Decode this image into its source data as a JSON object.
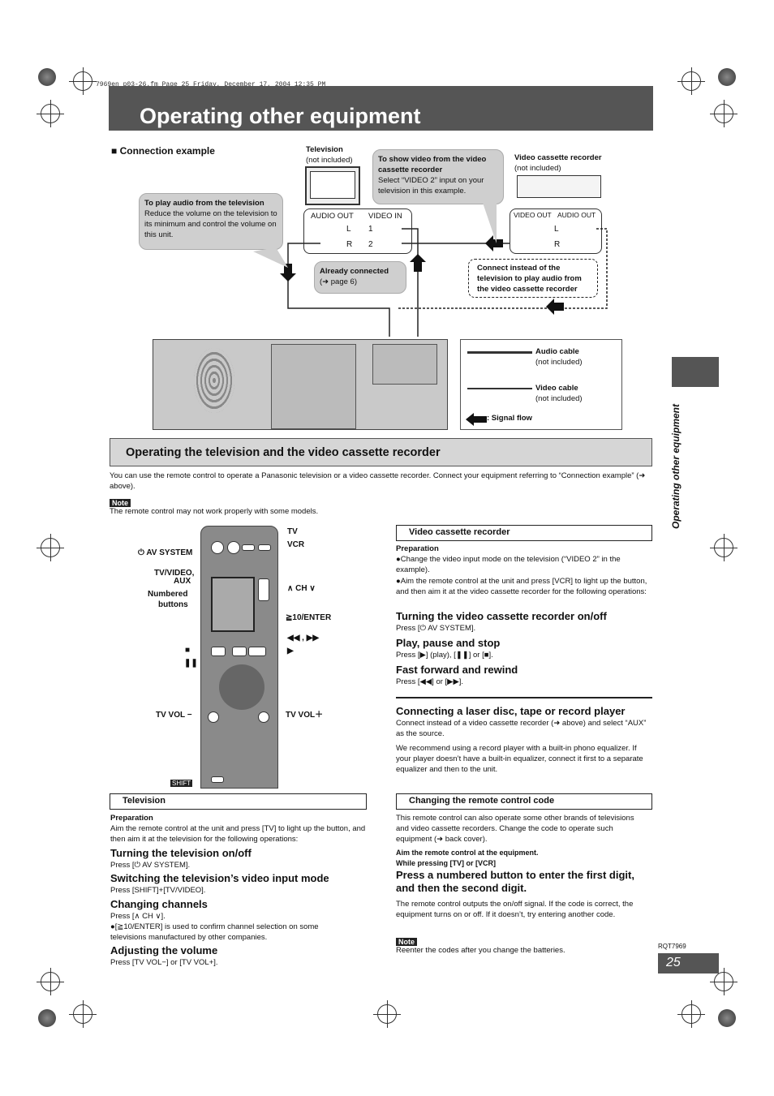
{
  "file_tag": "7969en_p03-26.fm  Page 25  Friday, December 17, 2004  12:35 PM",
  "title": "Operating other equipment",
  "connection": {
    "heading": "■ Connection example",
    "tv_title": "Television",
    "tv_sub": "(not included)",
    "vcr_title": "Video cassette recorder",
    "vcr_sub": "(not included)",
    "bubble_audio_title": "To play audio from the television",
    "bubble_audio_text": "Reduce the volume on the television to its minimum and control the volume on this unit.",
    "bubble_video_title": "To show video from the video cassette recorder",
    "bubble_video_text": "Select “VIDEO 2” input on your television in this example.",
    "already_title": "Already connected",
    "already_text": "(➜ page 6)",
    "instead_text": "Connect instead of the television to play audio from the video cassette recorder",
    "tv_audio_out": "AUDIO OUT",
    "tv_video_in": "VIDEO IN",
    "l": "L",
    "r": "R",
    "in1": "1",
    "in2": "2",
    "vcr_video_out": "VIDEO OUT",
    "vcr_audio_out": "AUDIO OUT",
    "legend": {
      "audio": "Audio cable",
      "audio_sub": "(not included)",
      "video": "Video cable",
      "video_sub": "(not included)",
      "signal": ": Signal flow"
    }
  },
  "section": {
    "title": "Operating the television and the video cassette recorder",
    "intro": "You can use the remote control to operate a Panasonic television or a video cassette recorder. Connect your equipment referring to “Connection example” (➜ above).",
    "note_label": "Note",
    "note": "The remote control may not work properly with some models."
  },
  "remote_labels": {
    "tv": "TV",
    "vcr": "VCR",
    "av_system": "⏻ AV SYSTEM",
    "tv_video": "TV/VIDEO,",
    "aux": "AUX",
    "numbered": "Numbered",
    "buttons": "buttons",
    "ch": "∧ CH ∨",
    "enter10": "≧10/ENTER",
    "skip": "◀◀ , ▶▶",
    "stop": "■",
    "pause": "❚❚",
    "play": "▶",
    "tv_vol_minus": "TV VOL −",
    "tv_vol_plus": "TV VOL＋",
    "shift": "SHIFT"
  },
  "television": {
    "box": "Television",
    "prep": "Preparation",
    "prep_text": "Aim the remote control at the unit and press [TV] to light up the button, and then aim it at the television for the following operations:",
    "items": [
      {
        "h": "Turning the television on/off",
        "t": "Press [⏻ AV SYSTEM]."
      },
      {
        "h": "Switching the television’s video input mode",
        "t": "Press [SHIFT]+[TV/VIDEO]."
      },
      {
        "h": "Changing channels",
        "t": "Press [∧ CH ∨]."
      },
      {
        "h": "Adjusting the volume",
        "t": "Press [TV VOL−] or [TV VOL+]."
      }
    ],
    "ch_bullet": "●[≧10/ENTER] is used to confirm channel selection on some televisions manufactured by other companies."
  },
  "vcr": {
    "box": "Video cassette recorder",
    "prep": "Preparation",
    "bullets": [
      "●Change the video input mode on the television (“VIDEO 2” in the example).",
      "●Aim the remote control at the unit and press [VCR] to light up the button, and then aim it at the video cassette recorder for the following operations:"
    ],
    "items": [
      {
        "h": "Turning the video cassette recorder on/off",
        "t": "Press [⏻ AV SYSTEM]."
      },
      {
        "h": "Play, pause and stop",
        "t": "Press [▶] (play), [❚❚] or [■]."
      },
      {
        "h": "Fast forward and rewind",
        "t": "Press [◀◀] or [▶▶]."
      }
    ]
  },
  "laser": {
    "h": "Connecting a laser disc, tape or record player",
    "p1": "Connect instead of a video cassette recorder (➜ above) and select “AUX” as the source.",
    "p2": "We recommend using a record player with a built-in phono equalizer. If your player doesn’t have a built-in equalizer, connect it first to a separate equalizer and then to the unit."
  },
  "code": {
    "box": "Changing the remote control code",
    "p1": "This remote control can also operate some other brands of televisions and video cassette recorders. Change the code to operate such equipment (➜ back cover).",
    "s1": "Aim the remote control at the equipment.",
    "s2": "While pressing [TV] or [VCR]",
    "h": "Press a numbered button to enter the first digit, and then the second digit.",
    "p2": "The remote control outputs the on/off signal. If the code is correct, the equipment turns on or off. If it doesn’t, try entering another code.",
    "note_label": "Note",
    "note": "Reenter the codes after you change the batteries."
  },
  "side_tab": "Operating other equipment",
  "doc_code": "RQT7969",
  "page_number": "25"
}
